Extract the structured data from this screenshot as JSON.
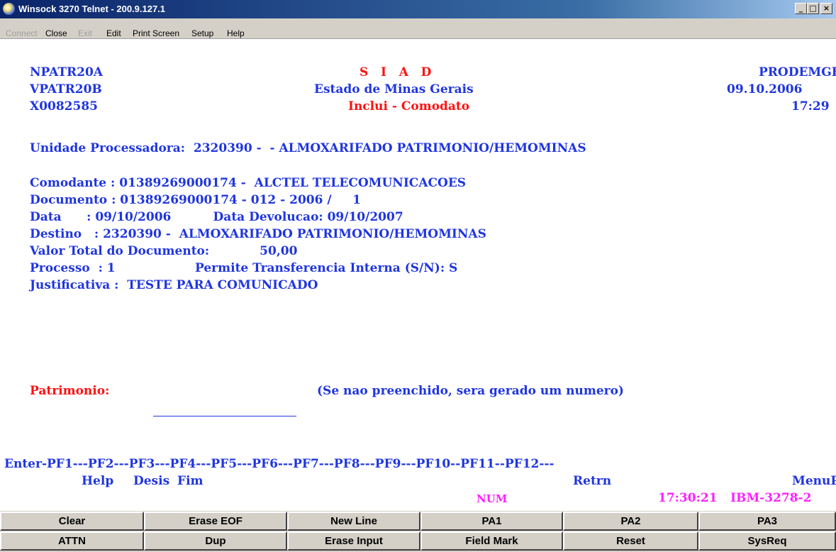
{
  "window": {
    "title": "Winsock 3270 Telnet - 200.9.127.1"
  },
  "menu": {
    "connect": "Connect",
    "close": "Close",
    "exit": "Exit",
    "edit": "Edit",
    "print_screen": "Print Screen",
    "setup": "Setup",
    "help": "Help"
  },
  "terminal": {
    "header": {
      "prog1": "NPATR20A",
      "prog2": "VPATR20B",
      "user": "X0082585",
      "system": "S   I   A   D",
      "state": "Estado de Minas Gerais",
      "operation": "Inclui - Comodato",
      "company": "PRODEMGE",
      "date": "09.10.2006",
      "time": "17:29"
    },
    "unidade": "Unidade Processadora:  2320390 -  - ALMOXARIFADO PATRIMONIO/HEMOMINAS",
    "lines": [
      "Comodante : 01389269000174 -  ALCTEL TELECOMUNICACOES",
      "Documento : 01389269000174 - 012 - 2006 /     1",
      "Data      : 09/10/2006          Data Devolucao: 09/10/2007",
      "Destino   : 2320390 -  ALMOXARIFADO PATRIMONIO/HEMOMINAS",
      "Valor Total do Documento:            50,00",
      "Processo  : 1                   Permite Transferencia Interna (S/N): S",
      "Justificativa :  TESTE PARA COMUNICADO"
    ],
    "patrimonio_label": "Patrimonio:",
    "patrimonio_value": "",
    "patrimonio_hint": "(Se nao preenchido, sera gerado um numero)",
    "pf_line": "Enter-PF1---PF2---PF3---PF4---PF5---PF6---PF7---PF8---PF9---PF10--PF11--PF12---",
    "pf_help": "Help",
    "pf_desis": "Desis",
    "pf_fim": "Fim",
    "pf_retrn": "Retrn",
    "pf_menup": "MenuP",
    "status": {
      "num": "NUM",
      "time": "17:30:21",
      "model": "IBM-3278-2"
    }
  },
  "keypad": {
    "row1": [
      "Clear",
      "Erase EOF",
      "New Line",
      "PA1",
      "PA2",
      "PA3"
    ],
    "row2": [
      "ATTN",
      "Dup",
      "Erase Input",
      "Field Mark",
      "Reset",
      "SysReq"
    ]
  }
}
